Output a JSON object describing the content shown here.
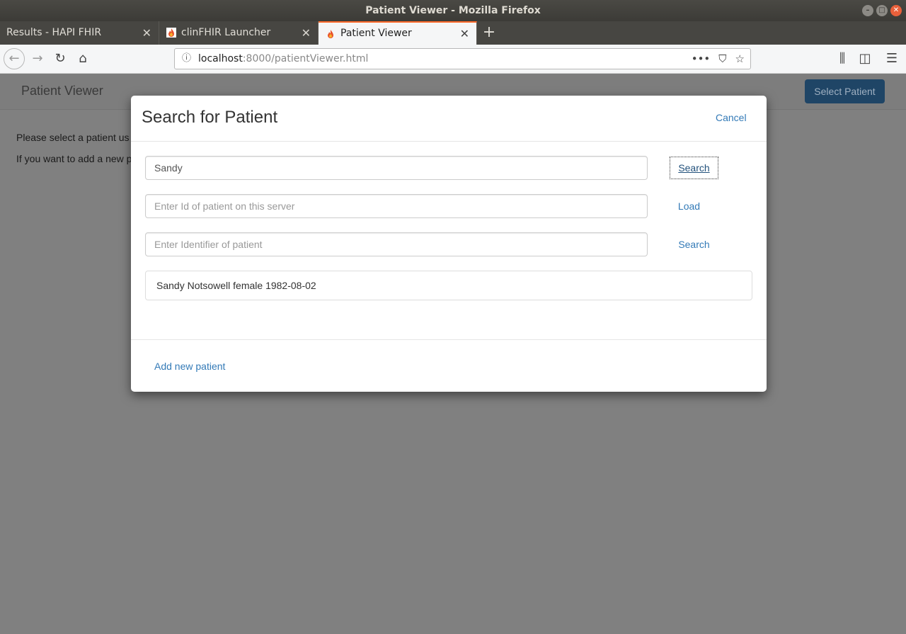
{
  "window": {
    "title": "Patient Viewer - Mozilla Firefox"
  },
  "tabs": [
    {
      "label": "Results - HAPI FHIR"
    },
    {
      "label": "clinFHIR Launcher"
    },
    {
      "label": "Patient Viewer"
    }
  ],
  "url": {
    "host": "localhost",
    "rest": ":8000/patientViewer.html"
  },
  "page": {
    "brand": "Patient Viewer",
    "select_patient_label": "Select Patient",
    "line1": "Please select a patient us",
    "line2": "If you want to add a new p"
  },
  "modal": {
    "title": "Search for Patient",
    "cancel_label": "Cancel",
    "name_search": {
      "value": "Sandy",
      "button": "Search"
    },
    "id_load": {
      "placeholder": "Enter Id of patient on this server",
      "button": "Load"
    },
    "identifier_search": {
      "placeholder": "Enter Identifier of patient",
      "button": "Search"
    },
    "results": [
      "Sandy Notsowell female 1982-08-02"
    ],
    "add_new_label": "Add new patient"
  },
  "colors": {
    "link": "#337ab7",
    "primary_button": "#337ab7",
    "active_tab_accent": "#ff6a2b"
  }
}
